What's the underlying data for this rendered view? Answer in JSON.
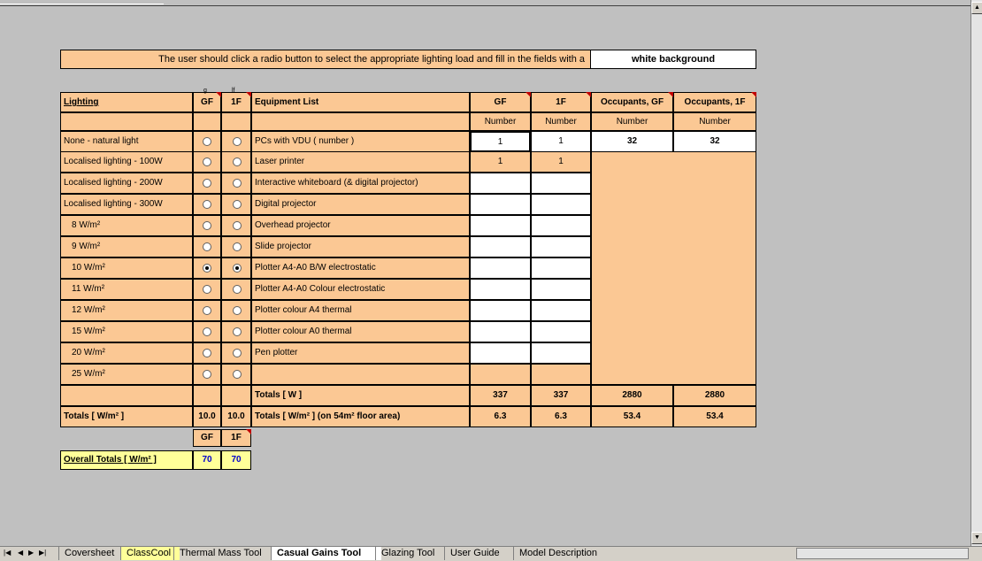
{
  "instructions": {
    "text": "The user should click a radio button to select the appropriate lighting load and fill in the fields with a",
    "highlight": "white background"
  },
  "headers": {
    "lighting": "Lighting",
    "gf": "GF",
    "f1": "1F",
    "gf_hidden": "g",
    "f1_hidden": "lf",
    "equipment": "Equipment List",
    "eq_gf": "GF",
    "eq_1f": "1F",
    "occ_gf": "Occupants, GF",
    "occ_1f": "Occupants, 1F",
    "number": "Number"
  },
  "lighting_options": [
    {
      "label": "None  - natural light",
      "gf_selected": false,
      "f1_selected": false
    },
    {
      "label": "Localised lighting - 100W",
      "gf_selected": false,
      "f1_selected": false
    },
    {
      "label": "Localised lighting - 200W",
      "gf_selected": false,
      "f1_selected": false
    },
    {
      "label": "Localised lighting - 300W",
      "gf_selected": false,
      "f1_selected": false
    },
    {
      "label": "8 W/m²",
      "gf_selected": false,
      "f1_selected": false
    },
    {
      "label": "9 W/m²",
      "gf_selected": false,
      "f1_selected": false
    },
    {
      "label": "10 W/m²",
      "gf_selected": true,
      "f1_selected": true
    },
    {
      "label": "11 W/m²",
      "gf_selected": false,
      "f1_selected": false
    },
    {
      "label": "12 W/m²",
      "gf_selected": false,
      "f1_selected": false
    },
    {
      "label": "15 W/m²",
      "gf_selected": false,
      "f1_selected": false
    },
    {
      "label": "20 W/m²",
      "gf_selected": false,
      "f1_selected": false
    },
    {
      "label": "25 W/m²",
      "gf_selected": false,
      "f1_selected": false
    }
  ],
  "equipment": [
    {
      "label": "PCs with VDU ( number )",
      "gf": "1",
      "f1": "1"
    },
    {
      "label": "Laser printer",
      "gf": "1",
      "f1": "1"
    },
    {
      "label": "Interactive whiteboard (& digital projector)",
      "gf": "",
      "f1": ""
    },
    {
      "label": "Digital projector",
      "gf": "",
      "f1": ""
    },
    {
      "label": "Overhead projector",
      "gf": "",
      "f1": ""
    },
    {
      "label": "Slide projector",
      "gf": "",
      "f1": ""
    },
    {
      "label": "Plotter A4-A0 B/W electrostatic",
      "gf": "",
      "f1": ""
    },
    {
      "label": "Plotter A4-A0 Colour electrostatic",
      "gf": "",
      "f1": ""
    },
    {
      "label": "Plotter colour A4 thermal",
      "gf": "",
      "f1": ""
    },
    {
      "label": "Plotter colour A0 thermal",
      "gf": "",
      "f1": ""
    },
    {
      "label": "Pen plotter",
      "gf": "",
      "f1": ""
    }
  ],
  "occupants": {
    "gf": "32",
    "f1": "32"
  },
  "totals_w": {
    "label": "Totals  [ W ]",
    "gf": "337",
    "f1": "337",
    "occ_gf": "2880",
    "occ_1f": "2880"
  },
  "totals_wm2": {
    "lighting_label": "Totals  [ W/m² ]",
    "light_gf": "10.0",
    "light_1f": "10.0",
    "label": "Totals [ W/m² ] (on 54m² floor area)",
    "gf": "6.3",
    "f1": "6.3",
    "occ_gf": "53.4",
    "occ_1f": "53.4"
  },
  "overall": {
    "label": "Overall Totals  [ W/m² ]",
    "gf_header": "GF",
    "f1_header": "1F",
    "gf": "70",
    "f1": "70"
  },
  "sheet_tabs": [
    {
      "label": "Coversheet",
      "active": false,
      "color": ""
    },
    {
      "label": "ClassCool",
      "active": false,
      "color": "#ffff99"
    },
    {
      "label": "Thermal Mass Tool",
      "active": false,
      "color": ""
    },
    {
      "label": "Casual Gains Tool",
      "active": true,
      "color": ""
    },
    {
      "label": "Glazing Tool",
      "active": false,
      "color": ""
    },
    {
      "label": "User Guide",
      "active": false,
      "color": ""
    },
    {
      "label": "Model Description",
      "active": false,
      "color": ""
    }
  ],
  "colors": {
    "peach": "#fbc894",
    "overall_yellow": "#ffff99",
    "overall_value": "#0000cc",
    "comment_marker": "#c00000"
  }
}
